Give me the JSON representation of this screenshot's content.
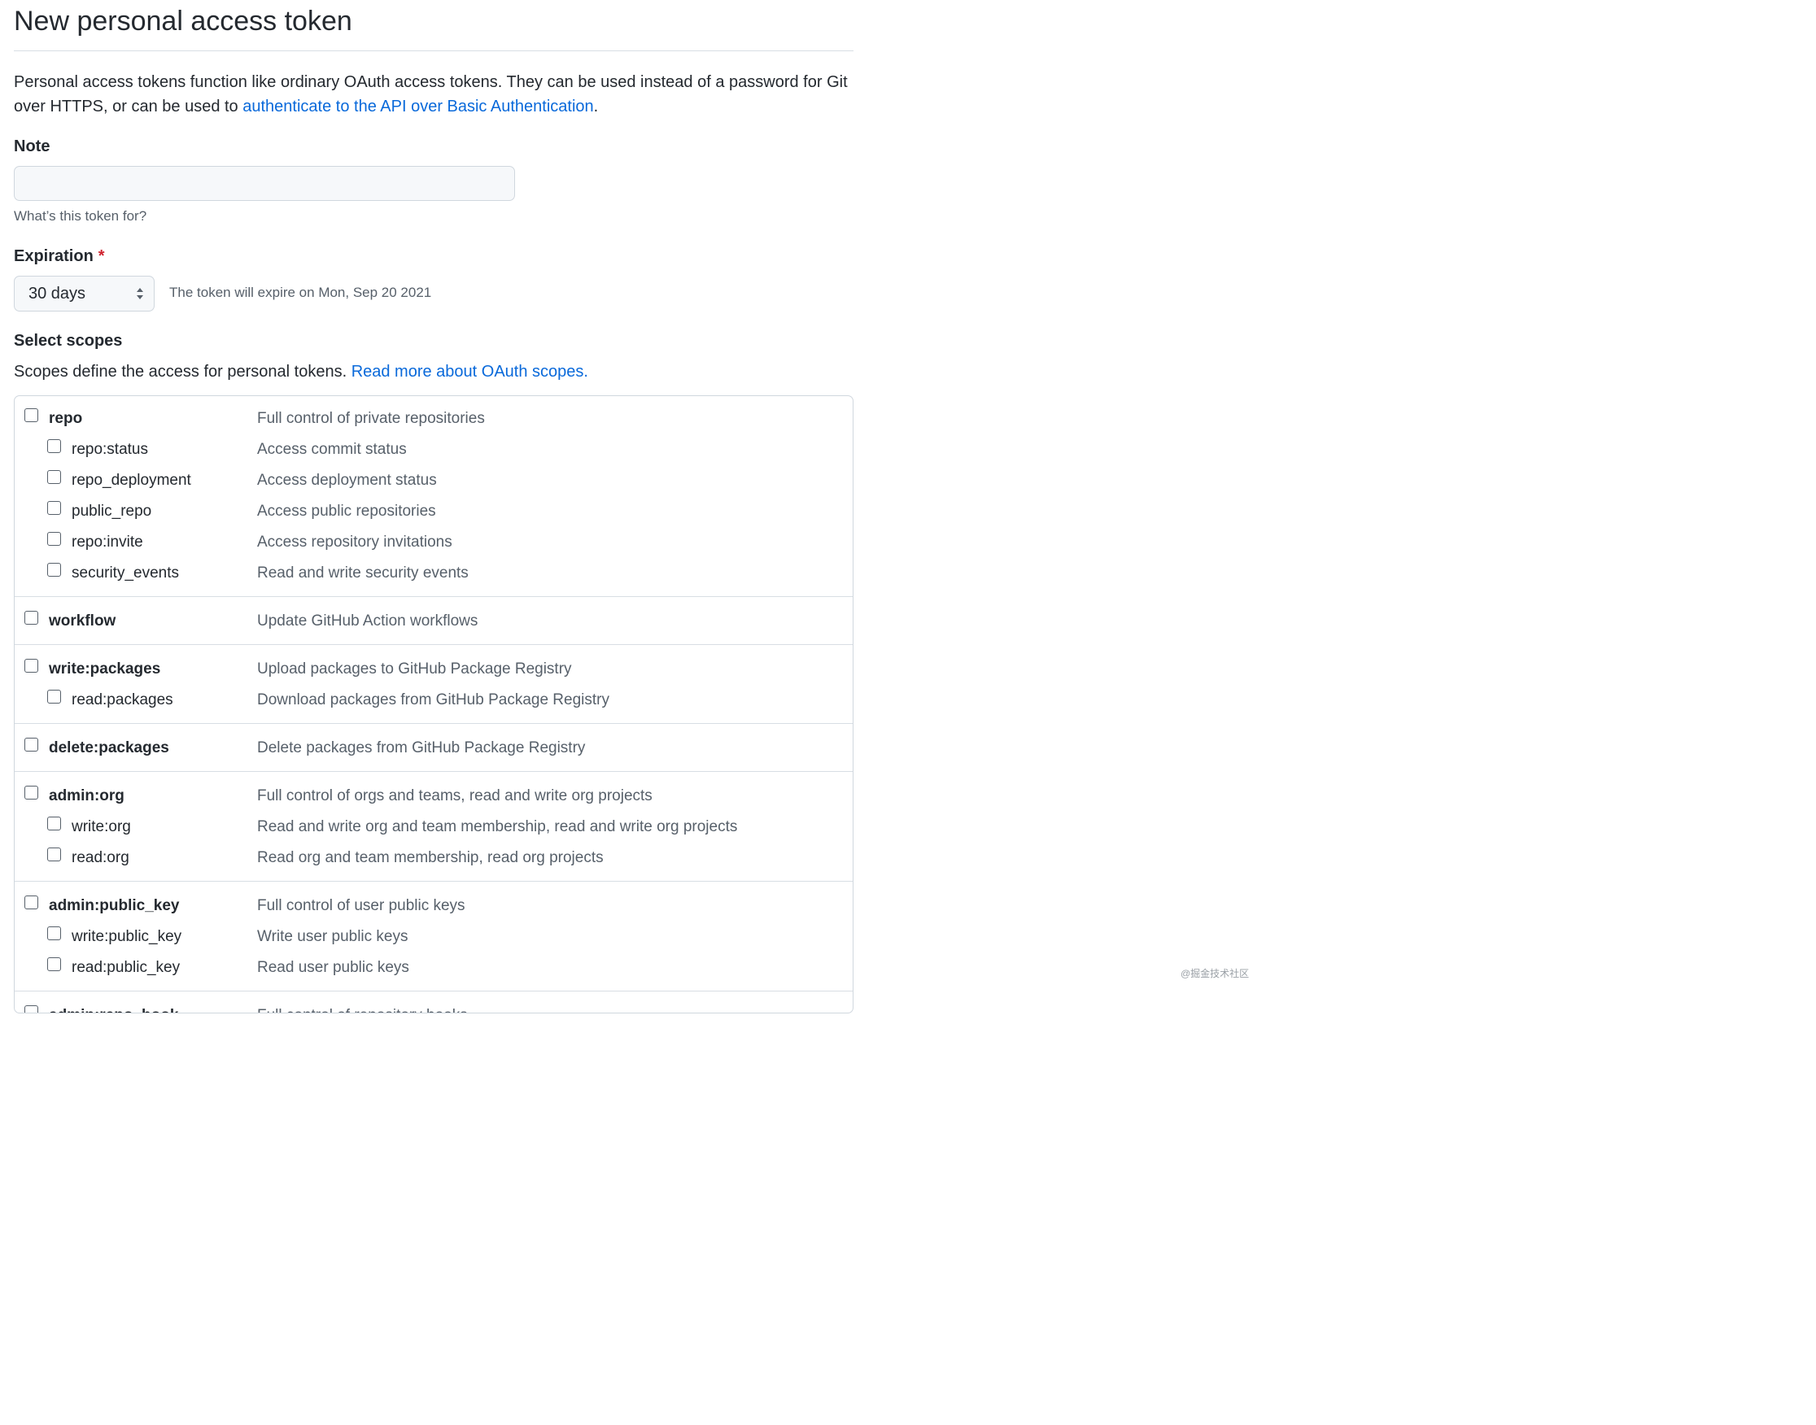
{
  "page": {
    "title": "New personal access token",
    "intro_text": "Personal access tokens function like ordinary OAuth access tokens. They can be used instead of a password for Git over HTTPS, or can be used to ",
    "intro_link": "authenticate to the API over Basic Authentication",
    "intro_end": "."
  },
  "note": {
    "label": "Note",
    "value": "",
    "placeholder": "",
    "hint": "What’s this token for?"
  },
  "expiration": {
    "label": "Expiration",
    "required_mark": "*",
    "selected": "30 days",
    "note": "The token will expire on Mon, Sep 20 2021"
  },
  "scopes": {
    "label": "Select scopes",
    "desc_text": "Scopes define the access for personal tokens. ",
    "desc_link": "Read more about OAuth scopes.",
    "groups": [
      {
        "name": "repo",
        "desc": "Full control of private repositories",
        "children": [
          {
            "name": "repo:status",
            "desc": "Access commit status"
          },
          {
            "name": "repo_deployment",
            "desc": "Access deployment status"
          },
          {
            "name": "public_repo",
            "desc": "Access public repositories"
          },
          {
            "name": "repo:invite",
            "desc": "Access repository invitations"
          },
          {
            "name": "security_events",
            "desc": "Read and write security events"
          }
        ]
      },
      {
        "name": "workflow",
        "desc": "Update GitHub Action workflows",
        "children": []
      },
      {
        "name": "write:packages",
        "desc": "Upload packages to GitHub Package Registry",
        "children": [
          {
            "name": "read:packages",
            "desc": "Download packages from GitHub Package Registry"
          }
        ]
      },
      {
        "name": "delete:packages",
        "desc": "Delete packages from GitHub Package Registry",
        "children": []
      },
      {
        "name": "admin:org",
        "desc": "Full control of orgs and teams, read and write org projects",
        "children": [
          {
            "name": "write:org",
            "desc": "Read and write org and team membership, read and write org projects"
          },
          {
            "name": "read:org",
            "desc": "Read org and team membership, read org projects"
          }
        ]
      },
      {
        "name": "admin:public_key",
        "desc": "Full control of user public keys",
        "children": [
          {
            "name": "write:public_key",
            "desc": "Write user public keys"
          },
          {
            "name": "read:public_key",
            "desc": "Read user public keys"
          }
        ]
      },
      {
        "name": "admin:repo_hook",
        "desc": "Full control of repository hooks",
        "children": []
      }
    ]
  },
  "watermark": "@掘金技术社区",
  "colors": {
    "link": "#0969da",
    "required": "#cf222e",
    "muted_text": "#57606a",
    "border": "#d0d7de"
  }
}
